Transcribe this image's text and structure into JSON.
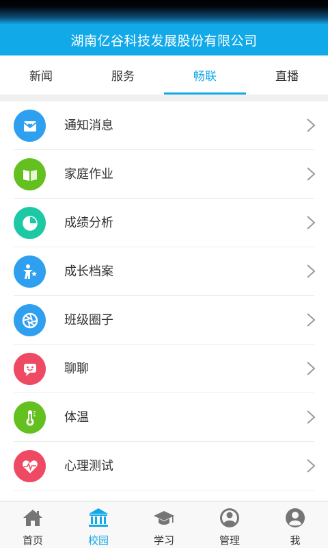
{
  "header": {
    "title": "湖南亿谷科技发展股份有限公司"
  },
  "tabs": [
    {
      "label": "新闻",
      "active": false
    },
    {
      "label": "服务",
      "active": false
    },
    {
      "label": "畅联",
      "active": true
    },
    {
      "label": "直播",
      "active": false
    }
  ],
  "menu": [
    {
      "label": "通知消息",
      "icon": "notification-icon",
      "color": "#2f9ff0"
    },
    {
      "label": "家庭作业",
      "icon": "homework-book-icon",
      "color": "#63c01f"
    },
    {
      "label": "成绩分析",
      "icon": "grade-analysis-pie-icon",
      "color": "#1dc9a4"
    },
    {
      "label": "成长档案",
      "icon": "growth-profile-icon",
      "color": "#2f9ff0"
    },
    {
      "label": "班级圈子",
      "icon": "class-circle-icon",
      "color": "#2f9ff0"
    },
    {
      "label": "聊聊",
      "icon": "chat-icon",
      "color": "#ef4a64"
    },
    {
      "label": "体温",
      "icon": "thermometer-icon",
      "color": "#63c01f"
    },
    {
      "label": "心理测试",
      "icon": "heart-pulse-icon",
      "color": "#ef4a64"
    }
  ],
  "bottom_nav": [
    {
      "label": "首页",
      "icon": "home-icon",
      "active": false
    },
    {
      "label": "校园",
      "icon": "campus-icon",
      "active": true
    },
    {
      "label": "学习",
      "icon": "graduation-cap-icon",
      "active": false
    },
    {
      "label": "管理",
      "icon": "management-icon",
      "active": false
    },
    {
      "label": "我",
      "icon": "user-icon",
      "active": false
    }
  ],
  "colors": {
    "accent": "#12a9e9",
    "nav_inactive": "#757575"
  }
}
